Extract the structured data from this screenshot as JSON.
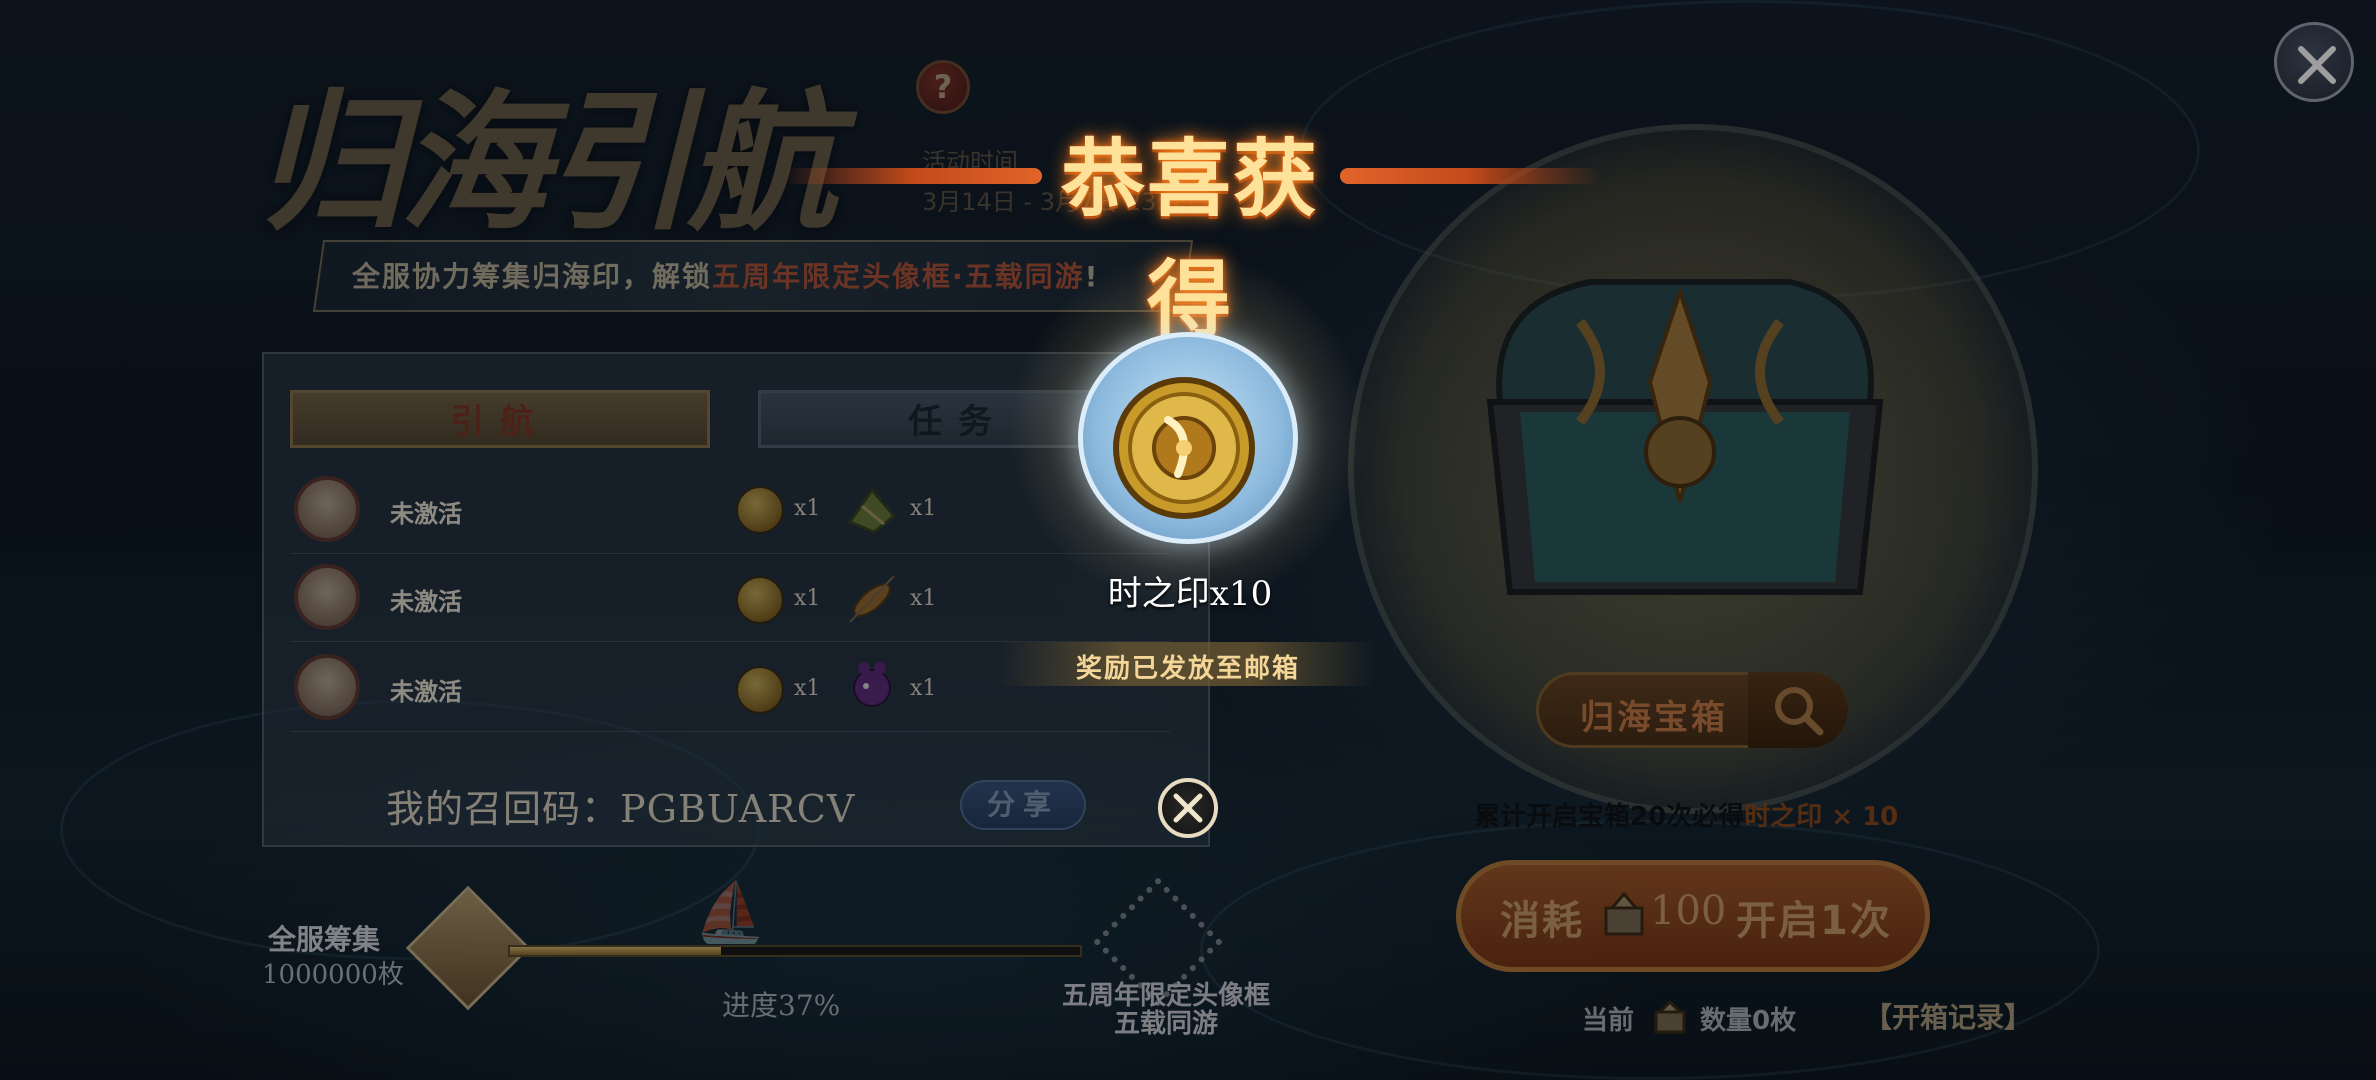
{
  "event": {
    "title": "归海引航",
    "help_label": "?",
    "time_label": "活动时间",
    "date_range": "3月14日 - 3月7日 23:59",
    "banner_prefix": "全服协力筹集归海印，解锁",
    "banner_highlight": "五周年限定头像框·五载同游",
    "banner_suffix": "!"
  },
  "tabs": [
    {
      "label": "引航",
      "active": true
    },
    {
      "label": "任务",
      "active": false
    }
  ],
  "guide_rows": [
    {
      "status": "未激活",
      "rewards": [
        {
          "icon": "seal-coin-icon",
          "qty": "x1"
        },
        {
          "icon": "zongzi-icon",
          "qty": "x1"
        }
      ]
    },
    {
      "status": "未激活",
      "rewards": [
        {
          "icon": "seal-coin-icon",
          "qty": "x1"
        },
        {
          "icon": "grilled-fish-icon",
          "qty": "x1"
        }
      ]
    },
    {
      "status": "未激活",
      "rewards": [
        {
          "icon": "seal-coin-icon",
          "qty": "x1"
        },
        {
          "icon": "purple-pet-icon",
          "qty": "x1"
        }
      ]
    }
  ],
  "recall": {
    "label": "我的召回码：PGBUARCV",
    "share_label": "分享"
  },
  "server_progress": {
    "label": "全服筹集",
    "count": "1000000枚",
    "percent": 37,
    "percent_text": "进度37%",
    "reward_label_1": "五周年限定头像框",
    "reward_label_2": "五载同游"
  },
  "chest": {
    "name": "归海宝箱",
    "guarantee_prefix": "累计开启宝箱20次必得",
    "guarantee_highlight": "时之印 × 10",
    "open_prefix": "消耗",
    "open_cost": "100",
    "open_suffix": "开启1次",
    "current_label": "当前",
    "current_count": "数量0枚",
    "open_log": "【开箱记录】"
  },
  "popup": {
    "title": "恭喜获得",
    "item_name": "时之印x10",
    "mail_notice": "奖励已发放至邮箱"
  },
  "colors": {
    "accent_gold": "#ffe29a",
    "highlight_red": "#c45a3a",
    "progress_fill": "#d6b870"
  }
}
